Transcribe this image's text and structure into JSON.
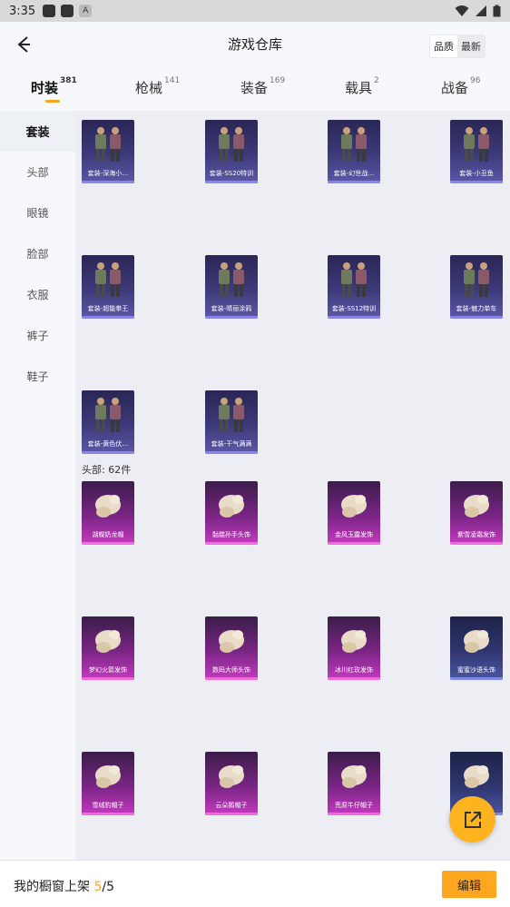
{
  "status_bar": {
    "time": "3:35"
  },
  "header": {
    "title": "游戏仓库",
    "sort_quality": "品质",
    "sort_latest": "最新"
  },
  "tabs": [
    {
      "label": "时装",
      "count": "381"
    },
    {
      "label": "枪械",
      "count": "141"
    },
    {
      "label": "装备",
      "count": "169"
    },
    {
      "label": "载具",
      "count": "2"
    },
    {
      "label": "战备",
      "count": "96"
    }
  ],
  "sidebar": [
    "套装",
    "头部",
    "眼镜",
    "脸部",
    "衣服",
    "裤子",
    "鞋子"
  ],
  "sections": {
    "suits": {
      "items": [
        "套装-深海小…",
        "套装-SS20特训",
        "套装-幻世战…",
        "套装-小丑鱼",
        "套装-超能拳王",
        "套装-晴丽涂鸦",
        "套装-SS12特训",
        "套装-魅力单车",
        "套装-黄色伏…",
        "套装-干气满满"
      ]
    },
    "head": {
      "title": "头部: 62件",
      "items": [
        "湖蝶奶龙帽",
        "骷髅孙手头饰",
        "金风玉露发饰",
        "紫雪凌霜发饰",
        "梦幻火箭发饰",
        "数码大师头饰",
        "冰川红玫发饰",
        "蜜蜜沙语头饰",
        "雪绒豹帽子",
        "云朵鹅帽子",
        "荒原牛仔帽子",
        ""
      ]
    }
  },
  "bottom": {
    "showcase_label": "我的橱窗上架",
    "current": "5",
    "separator": "/",
    "total": "5",
    "edit_label": "编辑"
  },
  "colors": {
    "accent": "#ffa31a",
    "rare_suit": "#3d3a7a",
    "epic_item": "#c43bbf"
  }
}
